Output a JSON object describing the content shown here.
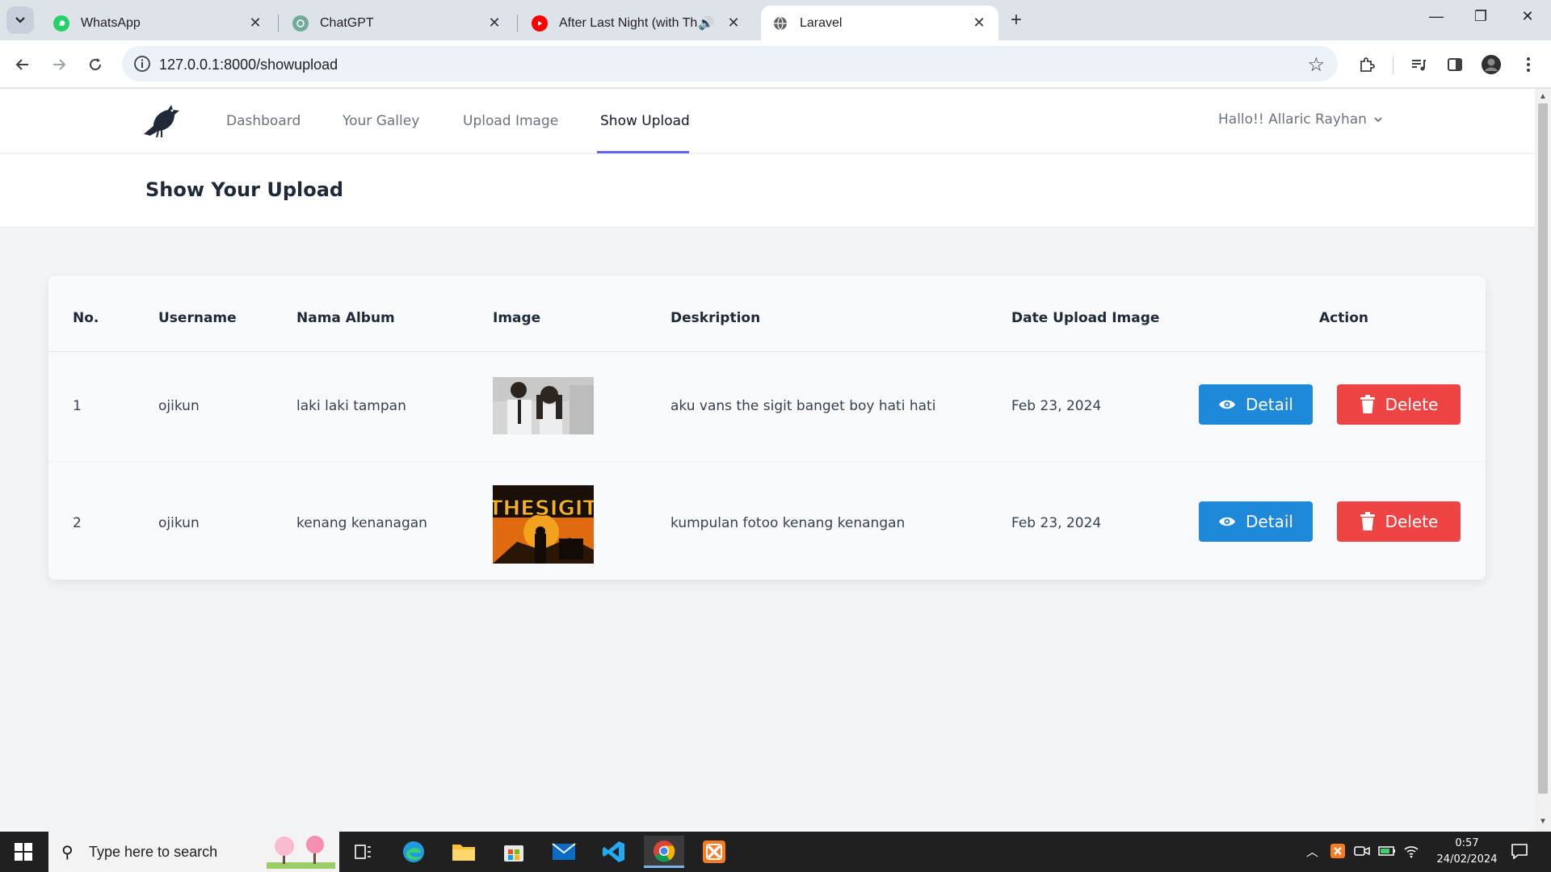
{
  "browser": {
    "tabs": [
      {
        "title": "WhatsApp",
        "active": false
      },
      {
        "title": "ChatGPT",
        "active": false
      },
      {
        "title": "After Last Night (with Thund",
        "active": false,
        "playing_audio": true
      },
      {
        "title": "Laravel",
        "active": true
      }
    ],
    "new_tab_icon": "plus-icon",
    "url": "127.0.0.1:8000/showupload"
  },
  "app": {
    "nav": {
      "items": [
        "Dashboard",
        "Your Galley",
        "Upload Image",
        "Show Upload"
      ],
      "active": "Show Upload",
      "user_greeting": "Hallo!! Allaric Rayhan"
    },
    "header_title": "Show Your Upload",
    "table": {
      "columns": [
        "No.",
        "Username",
        "Nama Album",
        "Image",
        "Deskription",
        "Date Upload Image",
        "Action"
      ],
      "rows": [
        {
          "no": "1",
          "username": "ojikun",
          "album": "laki laki tampan",
          "image": "photo-two-students",
          "description": "aku vans the sigit banget boy hati hati",
          "date": "Feb 23, 2024"
        },
        {
          "no": "2",
          "username": "ojikun",
          "album": "kenang kenanagan",
          "image": "the-sigit-poster",
          "description": "kumpulan fotoo kenang kenangan",
          "date": "Feb 23, 2024"
        }
      ],
      "detail_label": "Detail",
      "delete_label": "Delete"
    },
    "image_text": {
      "poster_logo": "THESIGIT"
    }
  },
  "taskbar": {
    "search_placeholder": "Type here to search",
    "time": "0:57",
    "date": "24/02/2024"
  },
  "colors": {
    "detail_button": "#1e88d9",
    "delete_button": "#ef4444",
    "nav_active_underline": "#6366f1"
  }
}
